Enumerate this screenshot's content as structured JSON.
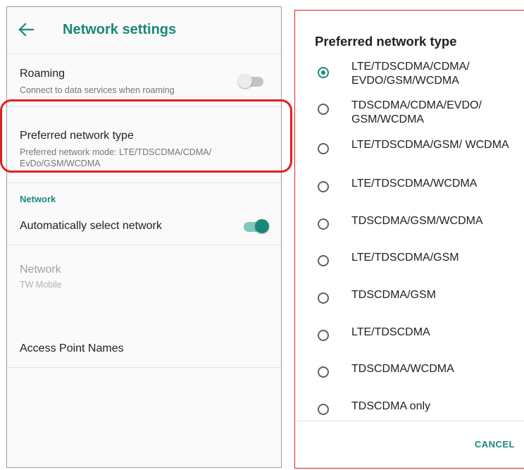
{
  "settings": {
    "title": "Network settings",
    "roaming": {
      "title": "Roaming",
      "subtitle": "Connect to data services when roaming",
      "enabled": false
    },
    "preferred_network": {
      "title": "Preferred network type",
      "subtitle": "Preferred network mode: LTE/TDSCDMA/CDMA/ EvDo/GSM/WCDMA"
    },
    "section_network": "Network",
    "auto_select": {
      "title": "Automatically select network",
      "enabled": true
    },
    "network": {
      "title": "Network",
      "subtitle": "TW Mobile"
    },
    "apn": {
      "title": "Access Point Names"
    }
  },
  "dialog": {
    "title": "Preferred network type",
    "options": [
      {
        "label": "LTE/TDSCDMA/CDMA/ EVDO/GSM/WCDMA",
        "selected": true
      },
      {
        "label": "TDSCDMA/CDMA/EVDO/ GSM/WCDMA",
        "selected": false
      },
      {
        "label": "LTE/TDSCDMA/GSM/ WCDMA",
        "selected": false
      },
      {
        "label": "LTE/TDSCDMA/WCDMA",
        "selected": false
      },
      {
        "label": "TDSCDMA/GSM/WCDMA",
        "selected": false
      },
      {
        "label": "LTE/TDSCDMA/GSM",
        "selected": false
      },
      {
        "label": "TDSCDMA/GSM",
        "selected": false
      },
      {
        "label": "LTE/TDSCDMA",
        "selected": false
      },
      {
        "label": "TDSCDMA/WCDMA",
        "selected": false
      },
      {
        "label": "TDSCDMA only",
        "selected": false
      }
    ],
    "cancel_label": "CANCEL"
  },
  "colors": {
    "accent": "#1b877a",
    "highlight": "#e02020"
  },
  "icons": {
    "back": "back-arrow-icon"
  }
}
